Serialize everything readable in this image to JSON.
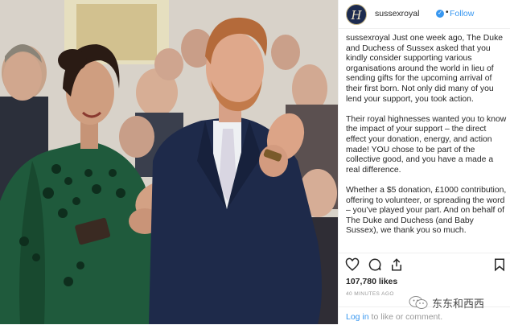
{
  "post": {
    "avatar_letter": "H",
    "username": "sussexroyal",
    "verified_mark": "✓",
    "dot": "•",
    "follow_label": "Follow",
    "caption": {
      "author": "sussexroyal",
      "p1": " Just one week ago, The Duke and Duchess of Sussex asked that you kindly consider supporting various organisations around the world in lieu of sending gifts for the upcoming arrival of their first born. Not only did many of you lend your support, you took action.",
      "p2": "Their royal highnesses wanted you to know the impact of your support – the direct effect your donation, energy, and action made! YOU chose to be part of the collective good, and you have a made a real difference.",
      "p3": "Whether a $5 donation, £1000 contribution, offering to volunteer, or spreading the word – you’ve played your part. And on behalf of The Duke and Duchess (and Baby Sussex), we thank you so much."
    },
    "likes": "107,780 likes",
    "time": "40 MINUTES AGO",
    "login": {
      "link": "Log in",
      "rest": " to like or comment."
    },
    "icons": [
      "heart-icon",
      "comment-icon",
      "share-icon",
      "bookmark-icon"
    ]
  },
  "watermark": {
    "text": "东东和西西",
    "icon": "wechat-icon"
  },
  "colors": {
    "link_blue": "#3897f0",
    "text": "#262626",
    "muted": "#999999",
    "coat_green": "#1f5a3c",
    "suit_navy": "#1e2a4a"
  }
}
